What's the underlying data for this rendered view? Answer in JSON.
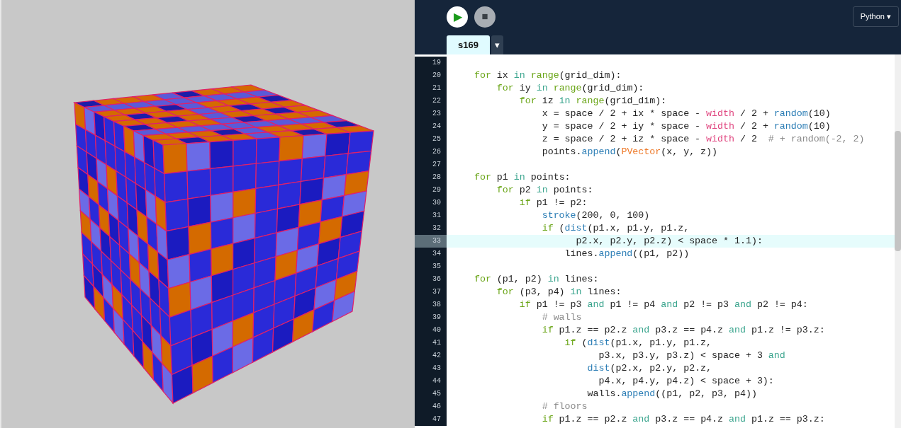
{
  "toolbar": {
    "run_button": {
      "label": "▶"
    },
    "stop_button": {
      "label": "■"
    },
    "mode": {
      "label": "Python ▾"
    }
  },
  "tabs": [
    {
      "label": "s169",
      "selected": true
    },
    {
      "label": "▾",
      "selected": false
    }
  ],
  "editor": {
    "lines": [
      {
        "number": "19",
        "highlighted": false
      },
      {
        "number": "20",
        "highlighted": false,
        "tokens": [
          {
            "text": "    for",
            "kind": "kw"
          },
          {
            "text": " ix ",
            "kind": "p"
          },
          {
            "text": "in",
            "kind": "op"
          },
          {
            "text": " range",
            "kind": "kw"
          },
          {
            "text": "(grid_dim):",
            "kind": "p"
          }
        ]
      },
      {
        "number": "21",
        "highlighted": false,
        "tokens": [
          {
            "text": "        for",
            "kind": "kw"
          },
          {
            "text": " iy ",
            "kind": "p"
          },
          {
            "text": "in",
            "kind": "op"
          },
          {
            "text": " range",
            "kind": "kw"
          },
          {
            "text": "(grid_dim):",
            "kind": "p"
          }
        ]
      },
      {
        "number": "22",
        "highlighted": false,
        "tokens": [
          {
            "text": "            for",
            "kind": "kw"
          },
          {
            "text": " iz ",
            "kind": "p"
          },
          {
            "text": "in",
            "kind": "op"
          },
          {
            "text": " range",
            "kind": "kw"
          },
          {
            "text": "(grid_dim):",
            "kind": "p"
          }
        ]
      },
      {
        "number": "23",
        "highlighted": false,
        "tokens": [
          {
            "text": "                x = space / 2 + ix * space - ",
            "kind": "p"
          },
          {
            "text": "width",
            "kind": "var"
          },
          {
            "text": " / 2 + ",
            "kind": "p"
          },
          {
            "text": "random",
            "kind": "fn"
          },
          {
            "text": "(10)",
            "kind": "p"
          }
        ]
      },
      {
        "number": "24",
        "highlighted": false,
        "tokens": [
          {
            "text": "                y = space / 2 + iy * space - ",
            "kind": "p"
          },
          {
            "text": "width",
            "kind": "var"
          },
          {
            "text": " / 2 + ",
            "kind": "p"
          },
          {
            "text": "random",
            "kind": "fn"
          },
          {
            "text": "(10)",
            "kind": "p"
          }
        ]
      },
      {
        "number": "25",
        "highlighted": false,
        "tokens": [
          {
            "text": "                z = space / 2 + iz * space - ",
            "kind": "p"
          },
          {
            "text": "width",
            "kind": "var"
          },
          {
            "text": " / 2",
            "kind": "p"
          },
          {
            "text": "  # + random(-2, 2)",
            "kind": "cm"
          }
        ]
      },
      {
        "number": "26",
        "highlighted": false,
        "tokens": [
          {
            "text": "                points.",
            "kind": "p"
          },
          {
            "text": "append",
            "kind": "fn"
          },
          {
            "text": "(",
            "kind": "p"
          },
          {
            "text": "PVector",
            "kind": "cls"
          },
          {
            "text": "(x, y, z))",
            "kind": "p"
          }
        ]
      },
      {
        "number": "27",
        "highlighted": false
      },
      {
        "number": "28",
        "highlighted": false,
        "tokens": [
          {
            "text": "    for",
            "kind": "kw"
          },
          {
            "text": " p1 ",
            "kind": "p"
          },
          {
            "text": "in",
            "kind": "op"
          },
          {
            "text": " points:",
            "kind": "p"
          }
        ]
      },
      {
        "number": "29",
        "highlighted": false,
        "tokens": [
          {
            "text": "        for",
            "kind": "kw"
          },
          {
            "text": " p2 ",
            "kind": "p"
          },
          {
            "text": "in",
            "kind": "op"
          },
          {
            "text": " points:",
            "kind": "p"
          }
        ]
      },
      {
        "number": "30",
        "highlighted": false,
        "tokens": [
          {
            "text": "            if",
            "kind": "kw"
          },
          {
            "text": " p1 != p2:",
            "kind": "p"
          }
        ]
      },
      {
        "number": "31",
        "highlighted": false,
        "tokens": [
          {
            "text": "                stroke",
            "kind": "fn"
          },
          {
            "text": "(200, 0, 100)",
            "kind": "p"
          }
        ]
      },
      {
        "number": "32",
        "highlighted": false,
        "tokens": [
          {
            "text": "                if",
            "kind": "kw"
          },
          {
            "text": " (",
            "kind": "p"
          },
          {
            "text": "dist",
            "kind": "fn"
          },
          {
            "text": "(p1.x, p1.y, p1.z,",
            "kind": "p"
          }
        ]
      },
      {
        "number": "33",
        "highlighted": true,
        "tokens": [
          {
            "text": "                      p2.x, p2.y, p2.z) < space * 1.1):",
            "kind": "p"
          }
        ]
      },
      {
        "number": "34",
        "highlighted": false,
        "tokens": [
          {
            "text": "                    lines.",
            "kind": "p"
          },
          {
            "text": "append",
            "kind": "fn"
          },
          {
            "text": "((p1, p2))",
            "kind": "p"
          }
        ]
      },
      {
        "number": "35",
        "highlighted": false
      },
      {
        "number": "36",
        "highlighted": false,
        "tokens": [
          {
            "text": "    for",
            "kind": "kw"
          },
          {
            "text": " (p1, p2) ",
            "kind": "p"
          },
          {
            "text": "in",
            "kind": "op"
          },
          {
            "text": " lines:",
            "kind": "p"
          }
        ]
      },
      {
        "number": "37",
        "highlighted": false,
        "tokens": [
          {
            "text": "        for",
            "kind": "kw"
          },
          {
            "text": " (p3, p4) ",
            "kind": "p"
          },
          {
            "text": "in",
            "kind": "op"
          },
          {
            "text": " lines:",
            "kind": "p"
          }
        ]
      },
      {
        "number": "38",
        "highlighted": false,
        "tokens": [
          {
            "text": "            if",
            "kind": "kw"
          },
          {
            "text": " p1 != p3 ",
            "kind": "p"
          },
          {
            "text": "and",
            "kind": "op"
          },
          {
            "text": " p1 != p4 ",
            "kind": "p"
          },
          {
            "text": "and",
            "kind": "op"
          },
          {
            "text": " p2 != p3 ",
            "kind": "p"
          },
          {
            "text": "and",
            "kind": "op"
          },
          {
            "text": " p2 != p4:",
            "kind": "p"
          }
        ]
      },
      {
        "number": "39",
        "highlighted": false,
        "tokens": [
          {
            "text": "                # walls",
            "kind": "cm"
          }
        ]
      },
      {
        "number": "40",
        "highlighted": false,
        "tokens": [
          {
            "text": "                if",
            "kind": "kw"
          },
          {
            "text": " p1.z == p2.z ",
            "kind": "p"
          },
          {
            "text": "and",
            "kind": "op"
          },
          {
            "text": " p3.z == p4.z ",
            "kind": "p"
          },
          {
            "text": "and",
            "kind": "op"
          },
          {
            "text": " p1.z != p3.z:",
            "kind": "p"
          }
        ]
      },
      {
        "number": "41",
        "highlighted": false,
        "tokens": [
          {
            "text": "                    if",
            "kind": "kw"
          },
          {
            "text": " (",
            "kind": "p"
          },
          {
            "text": "dist",
            "kind": "fn"
          },
          {
            "text": "(p1.x, p1.y, p1.z,",
            "kind": "p"
          }
        ]
      },
      {
        "number": "42",
        "highlighted": false,
        "tokens": [
          {
            "text": "                          p3.x, p3.y, p3.z) < space + 3 ",
            "kind": "p"
          },
          {
            "text": "and",
            "kind": "op"
          }
        ]
      },
      {
        "number": "43",
        "highlighted": false,
        "tokens": [
          {
            "text": "                        dist",
            "kind": "fn"
          },
          {
            "text": "(p2.x, p2.y, p2.z,",
            "kind": "p"
          }
        ]
      },
      {
        "number": "44",
        "highlighted": false,
        "tokens": [
          {
            "text": "                          p4.x, p4.y, p4.z) < space + 3):",
            "kind": "p"
          }
        ]
      },
      {
        "number": "45",
        "highlighted": false,
        "tokens": [
          {
            "text": "                        walls.",
            "kind": "p"
          },
          {
            "text": "append",
            "kind": "fn"
          },
          {
            "text": "((p1, p2, p3, p4))",
            "kind": "p"
          }
        ]
      },
      {
        "number": "46",
        "highlighted": false,
        "tokens": [
          {
            "text": "                # floors",
            "kind": "cm"
          }
        ]
      },
      {
        "number": "47",
        "highlighted": false,
        "tokens": [
          {
            "text": "                if",
            "kind": "kw"
          },
          {
            "text": " p1.z == p2.z ",
            "kind": "p"
          },
          {
            "text": "and",
            "kind": "op"
          },
          {
            "text": " p3.z == p4.z ",
            "kind": "p"
          },
          {
            "text": "and",
            "kind": "op"
          },
          {
            "text": " p1.z == p3.z:",
            "kind": "p"
          }
        ]
      }
    ]
  }
}
